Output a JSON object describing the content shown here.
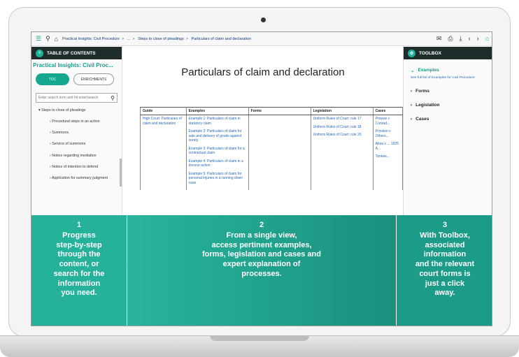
{
  "topnav": {
    "breadcrumb": [
      "Practical Insights: Civil Procedure",
      "...",
      "Steps to close of pleadings",
      "Particulars of claim and declaration"
    ]
  },
  "toc": {
    "header": "TABLE OF CONTENTS",
    "title": "Practical Insights: Civil Proc...",
    "tab_active": "TOC",
    "tab_inactive": "ENRICHMENTS",
    "search_placeholder": "Enter search term and hit enter/search",
    "items": [
      {
        "label": "Steps to close of pleadings",
        "level": "parent"
      },
      {
        "label": "Procedural steps in an action",
        "level": "child"
      },
      {
        "label": "Summons",
        "level": "child"
      },
      {
        "label": "Service of summons",
        "level": "child"
      },
      {
        "label": "Notice regarding mediation",
        "level": "child"
      },
      {
        "label": "Notice of intention to defend",
        "level": "child"
      },
      {
        "label": "Application for summary judgment",
        "level": "child"
      }
    ]
  },
  "document": {
    "title": "Particulars of claim and declaration",
    "columns": [
      "Guide",
      "Examples",
      "Forms",
      "Legislation",
      "Cases"
    ],
    "guide": [
      "High Court: Particulars of claim and declaration"
    ],
    "examples": [
      "Example 1: Particulars of claim in statutory claim",
      "Example 2: Particulars of claim for sale and delivery of goods against surety",
      "Example 3: Particulars of claim for a contractual claim",
      "Example 4: Particulars of claim in a divorce action",
      "Example 5: Particulars of claim for personal injuries in a running down case"
    ],
    "forms": [],
    "legislation": [
      "Uniform Rules of Court: rule 17",
      "Uniform Rules of Court: rule 18",
      "Uniform Rules of Court: rule 20"
    ],
    "cases": [
      "Prowse v Conrad...",
      "Prinsloo v Others...",
      "Absa v ... 1925 A...",
      "Tannas..."
    ]
  },
  "toolbox": {
    "header": "TOOLBOX",
    "examples_label": "Examples",
    "examples_link": "See full list of Examples for Civil Procedure",
    "forms_label": "Forms",
    "legislation_label": "Legislation",
    "cases_label": "Cases"
  },
  "overlays": [
    {
      "num": "1",
      "text": "Progress\nstep-by-step\nthrough the\ncontent, or\nsearch for the\ninformation\nyou need."
    },
    {
      "num": "2",
      "text": "From a single view,\naccess pertinent examples,\nforms, legislation and cases and\nexpert explanation of\nprocesses."
    },
    {
      "num": "3",
      "text": "With Toolbox,\nassociated\ninformation\nand the relevant\ncourt forms is\njust a click\naway."
    }
  ]
}
